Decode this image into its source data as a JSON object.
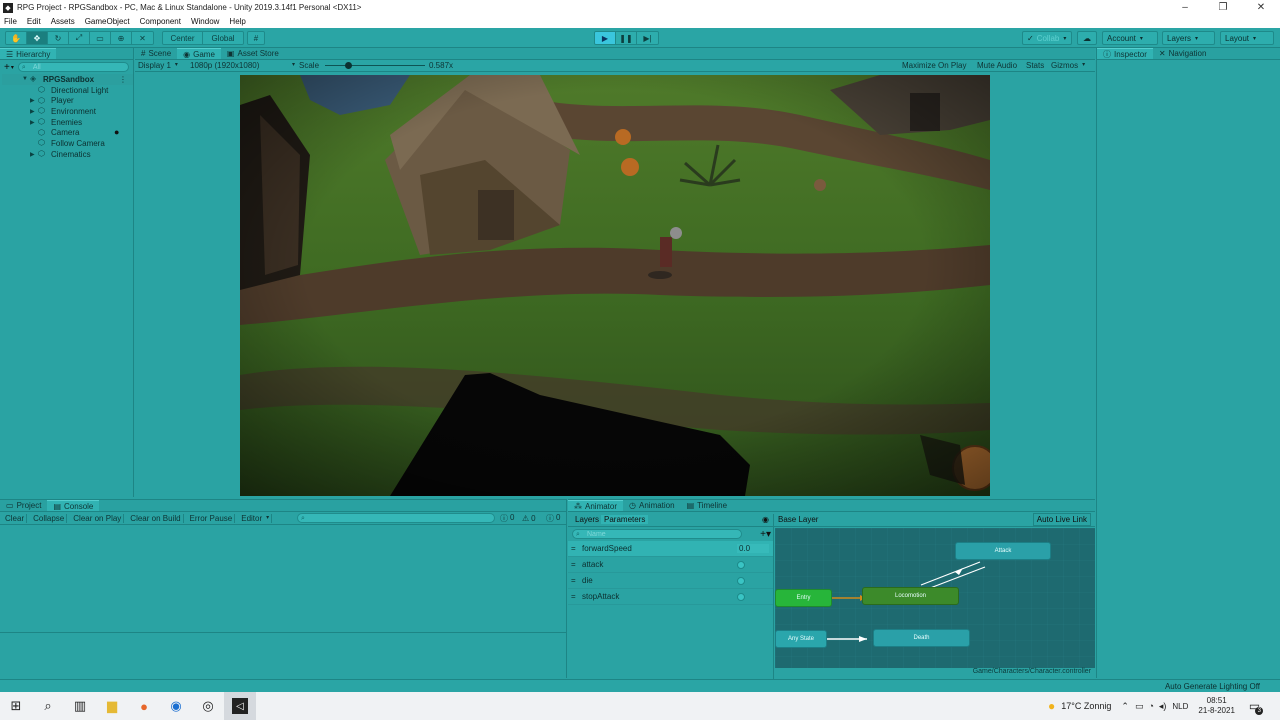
{
  "window": {
    "title": "RPG Project - RPGSandbox - PC, Mac & Linux Standalone - Unity 2019.3.14f1 Personal <DX11>",
    "minimize": "–",
    "maximize": "❐",
    "close": "✕"
  },
  "menu": [
    "File",
    "Edit",
    "Assets",
    "GameObject",
    "Component",
    "Window",
    "Help"
  ],
  "toolbar": {
    "pivot": "Center",
    "space": "Global",
    "collab": "Collab",
    "account": "Account",
    "layers": "Layers",
    "layout": "Layout"
  },
  "hierarchy": {
    "tab": "Hierarchy",
    "search_placeholder": "All",
    "scene": "RPGSandbox",
    "items": [
      {
        "label": "Directional Light",
        "expandable": false
      },
      {
        "label": "Player",
        "expandable": true
      },
      {
        "label": "Environment",
        "expandable": true
      },
      {
        "label": "Enemies",
        "expandable": true
      },
      {
        "label": "Camera",
        "expandable": false
      },
      {
        "label": "Follow Camera",
        "expandable": false
      },
      {
        "label": "Cinematics",
        "expandable": true
      }
    ]
  },
  "center_tabs": [
    "Scene",
    "Game",
    "Asset Store"
  ],
  "game": {
    "display": "Display 1",
    "resolution": "1080p (1920x1080)",
    "scale_label": "Scale",
    "scale_value": "0.587x",
    "scale_fraction": 0.2,
    "maximize_on_play": "Maximize On Play",
    "mute_audio": "Mute Audio",
    "stats": "Stats",
    "gizmos": "Gizmos"
  },
  "inspector_tabs": [
    "Inspector",
    "Navigation"
  ],
  "console": {
    "tabs": [
      "Project",
      "Console"
    ],
    "buttons": [
      "Clear",
      "Collapse",
      "Clear on Play",
      "Clear on Build",
      "Error Pause",
      "Editor"
    ],
    "counts": [
      "0",
      "0",
      "0"
    ]
  },
  "animator": {
    "tabs": [
      "Animator",
      "Animation",
      "Timeline"
    ],
    "subtabs": [
      "Layers",
      "Parameters"
    ],
    "name_placeholder": "Name",
    "base_layer": "Base Layer",
    "auto_live_link": "Auto Live Link",
    "params": [
      {
        "name": "forwardSpeed",
        "value": "0.0",
        "type": "float"
      },
      {
        "name": "attack",
        "type": "trigger"
      },
      {
        "name": "die",
        "type": "trigger"
      },
      {
        "name": "stopAttack",
        "type": "trigger"
      }
    ],
    "nodes": {
      "attack": "Attack",
      "entry": "Entry",
      "locomotion": "Locomotion",
      "any_state": "Any State",
      "death": "Death"
    },
    "controller_path": "Game/Characters/Character.controller"
  },
  "status": {
    "lighting": "Auto Generate Lighting Off"
  },
  "taskbar": {
    "weather": "17°C  Zonnig",
    "lang": "NLD",
    "time": "08:51",
    "date": "21-8-2021",
    "notif_count": "3"
  }
}
